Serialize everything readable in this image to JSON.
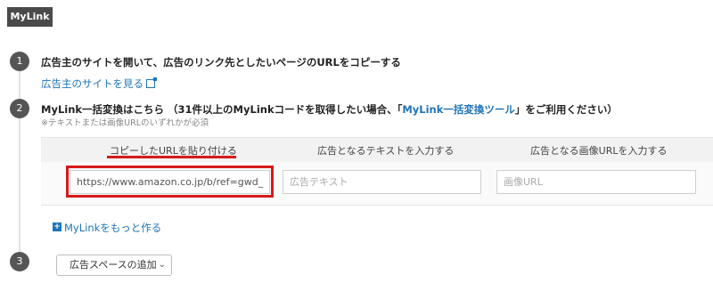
{
  "tag": {
    "label": "MyLink"
  },
  "steps": [
    {
      "number": "1",
      "title": "広告主のサイトを開いて、広告のリンク先としたいページのURLをコピーする",
      "link": "広告主のサイトを見る"
    },
    {
      "number": "2",
      "title_prefix": "MyLink一括変換はこちら （31件以上のMyLinkコードを取得したい場合、「",
      "title_link": "MyLink一括変換ツール",
      "title_suffix": "」をご利用ください）",
      "hint": "※テキストまたは画像URLのいずれかが必須"
    },
    {
      "number": "3"
    }
  ],
  "table": {
    "columns": [
      "コピーしたURLを貼り付ける",
      "広告となるテキストを入力する",
      "広告となる画像URLを入力する"
    ],
    "url_value": "https://www.amazon.co.jp/b/ref=gwd_",
    "text_placeholder": "広告テキスト",
    "image_placeholder": "画像URL"
  },
  "more_link": "MyLinkをもっと作る",
  "ad_space_select": {
    "selected": "広告スペースの追加"
  },
  "colors": {
    "link": "#1f74b8",
    "highlight": "#d61a1a",
    "badge": "#555555"
  },
  "icons": [
    "external-link-icon",
    "plus-square-icon",
    "chevron-down-icon"
  ]
}
